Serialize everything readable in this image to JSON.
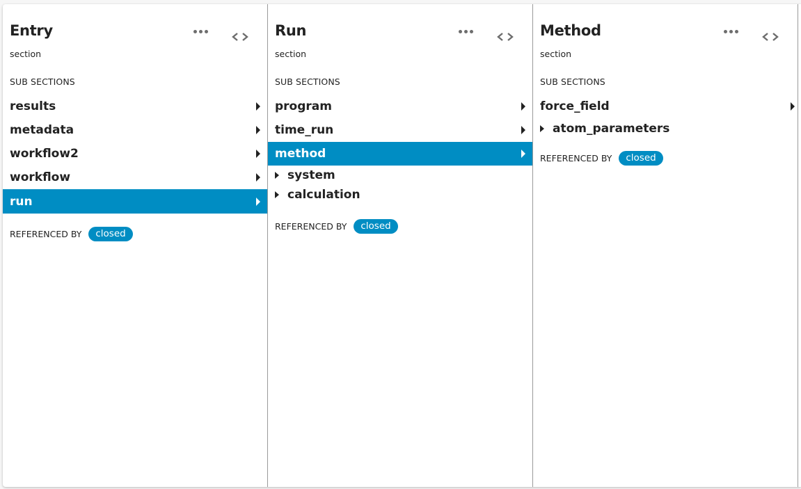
{
  "lanes": [
    {
      "title": "Entry",
      "subtitle": "section",
      "subsections_label": "SUB SECTIONS",
      "items": [
        {
          "label": "results",
          "selected": false
        },
        {
          "label": "metadata",
          "selected": false
        },
        {
          "label": "workflow2",
          "selected": false
        },
        {
          "label": "workflow",
          "selected": false
        },
        {
          "label": "run",
          "selected": true
        }
      ],
      "referenced_by_label": "REFERENCED BY",
      "referenced_by_chip": "closed"
    },
    {
      "title": "Run",
      "subtitle": "section",
      "subsections_label": "SUB SECTIONS",
      "items": [
        {
          "label": "program",
          "selected": false
        },
        {
          "label": "time_run",
          "selected": false
        },
        {
          "label": "method",
          "selected": true
        }
      ],
      "collapsed_groups": [
        "system",
        "calculation"
      ],
      "referenced_by_label": "REFERENCED BY",
      "referenced_by_chip": "closed"
    },
    {
      "title": "Method",
      "subtitle": "section",
      "subsections_label": "SUB SECTIONS",
      "items": [
        {
          "label": "force_field",
          "selected": false
        }
      ],
      "collapsed_groups": [
        "atom_parameters"
      ],
      "referenced_by_label": "REFERENCED BY",
      "referenced_by_chip": "closed"
    }
  ],
  "icons": {
    "more": "more-horizontal-icon",
    "code": "code-icon",
    "arrow": "arrow-right-icon",
    "expand": "expand-triangle-icon"
  },
  "colors": {
    "accent": "#008dc3",
    "text": "#222222",
    "icon": "#6d6d6d"
  }
}
